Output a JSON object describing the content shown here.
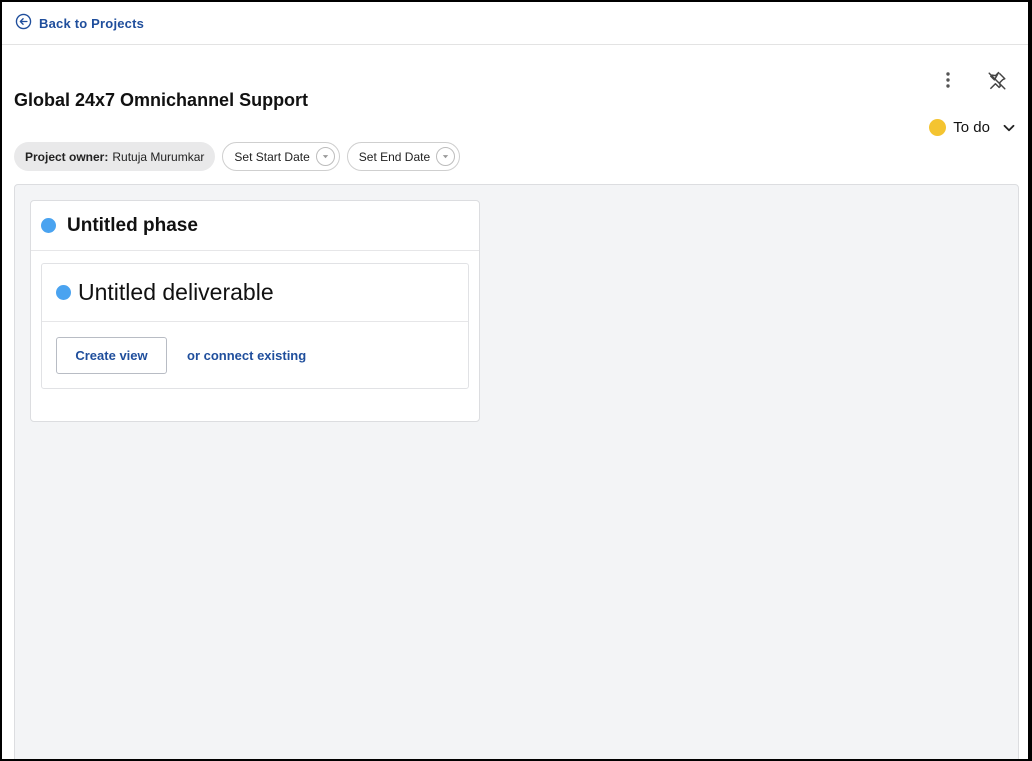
{
  "nav": {
    "back_label": "Back to Projects",
    "back_icon": "arrow-left-circle-icon"
  },
  "project": {
    "title": "Global 24x7 Omnichannel Support",
    "owner_label": "Project owner:",
    "owner_name": "Rutuja Murumkar",
    "start_date_label": "Set Start Date",
    "end_date_label": "Set End Date",
    "status": {
      "label": "To do",
      "color": "#f4c430"
    }
  },
  "phase": {
    "title": "Untitled phase",
    "color": "#4aa3f0",
    "deliverable": {
      "title": "Untitled deliverable",
      "create_view_label": "Create view",
      "connect_label": "or connect existing"
    }
  },
  "colors": {
    "accent": "#1f4e9c",
    "board_bg": "#f3f4f6"
  }
}
